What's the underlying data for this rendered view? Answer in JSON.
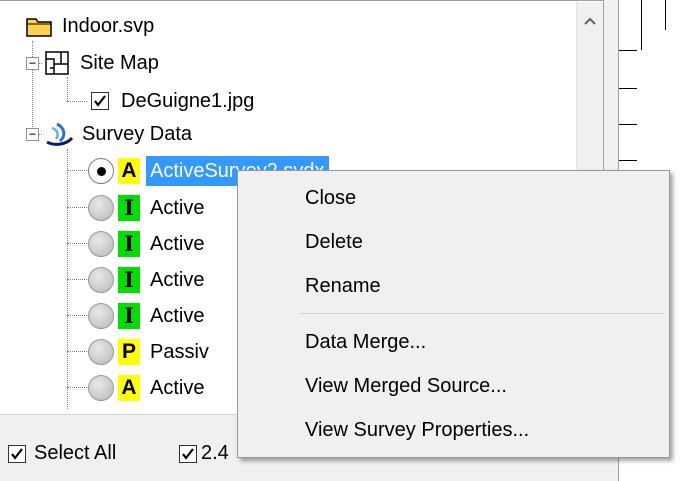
{
  "tree": {
    "root_label": "Indoor.svp",
    "site_map": {
      "label": "Site Map",
      "expander": "−",
      "children": [
        {
          "label": "DeGuigne1.jpg",
          "checked": true
        }
      ]
    },
    "survey_data": {
      "label": "Survey Data",
      "expander": "−",
      "items": [
        {
          "badge": "A",
          "label": "ActiveSurvey2.svdx",
          "selected": true,
          "radio": "on"
        },
        {
          "badge": "I",
          "label": "Active",
          "radio": "off"
        },
        {
          "badge": "I",
          "label": "Active",
          "radio": "off"
        },
        {
          "badge": "I",
          "label": "Active",
          "radio": "off"
        },
        {
          "badge": "I",
          "label": "Active",
          "radio": "off"
        },
        {
          "badge": "P",
          "label": "Passiv",
          "radio": "off"
        },
        {
          "badge": "A",
          "label": "Active",
          "radio": "off"
        }
      ]
    },
    "scroll_up_glyph": "^"
  },
  "bottom_bar": {
    "select_all_label": "Select All",
    "band_24_label": "2.4"
  },
  "context_menu": {
    "items": [
      {
        "label": "Close"
      },
      {
        "label": "Delete"
      },
      {
        "label": "Rename"
      },
      {
        "label": "Data Merge..."
      },
      {
        "label": "View Merged Source..."
      },
      {
        "label": "View Survey Properties..."
      }
    ]
  },
  "colors": {
    "selection": "#3399ff",
    "badge_active": "#ffff00",
    "badge_interval": "#00e000",
    "folder": "#ffd24d"
  }
}
